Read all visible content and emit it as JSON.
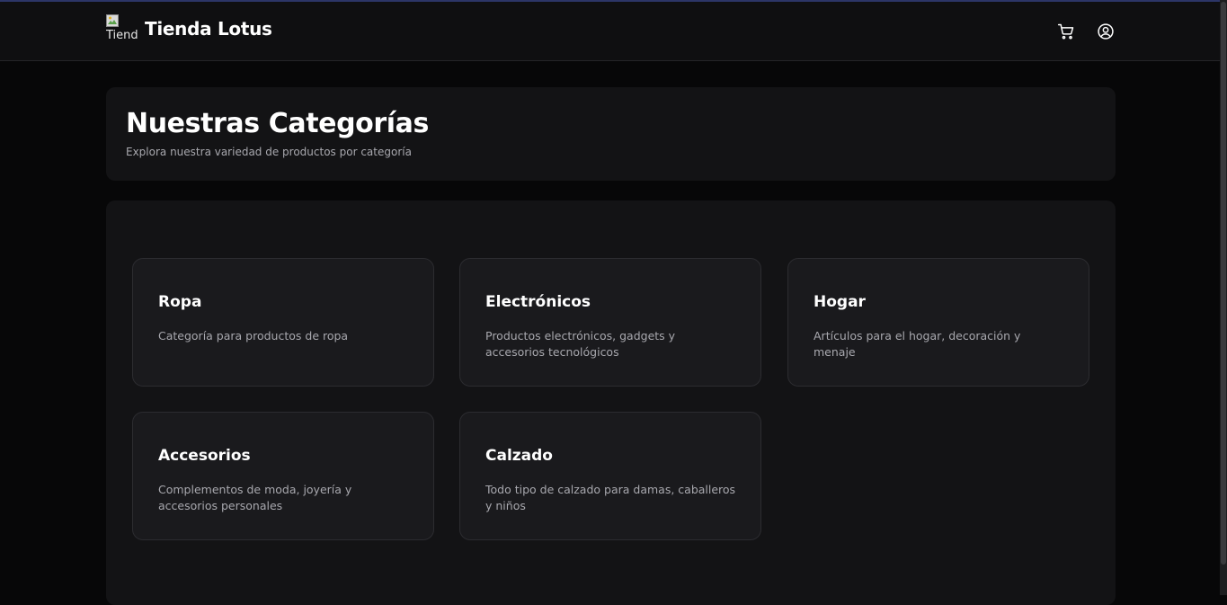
{
  "navbar": {
    "logo_alt": "Tienda Lotus",
    "brand_name": "Tienda Lotus",
    "icons": [
      "shopping-cart-icon",
      "user-circle-icon"
    ]
  },
  "hero": {
    "title": "Nuestras Categorías",
    "subtitle": "Explora nuestra variedad de productos por categoría"
  },
  "categories": [
    {
      "name": "Ropa",
      "description": "Categoría para productos de ropa"
    },
    {
      "name": "Electrónicos",
      "description": "Productos electrónicos, gadgets y accesorios tecnológicos"
    },
    {
      "name": "Hogar",
      "description": "Artículos para el hogar, decoración y menaje"
    },
    {
      "name": "Accesorios",
      "description": "Complementos de moda, joyería y accesorios personales"
    },
    {
      "name": "Calzado",
      "description": "Todo tipo de calzado para damas, caballeros y niños"
    }
  ],
  "colors": {
    "background": "#070708",
    "navbar": "#0f0f11",
    "panel": "#131315",
    "card": "#1a1a1d",
    "muted_text": "#a8a8ae",
    "accent_line": "#2c3567"
  }
}
